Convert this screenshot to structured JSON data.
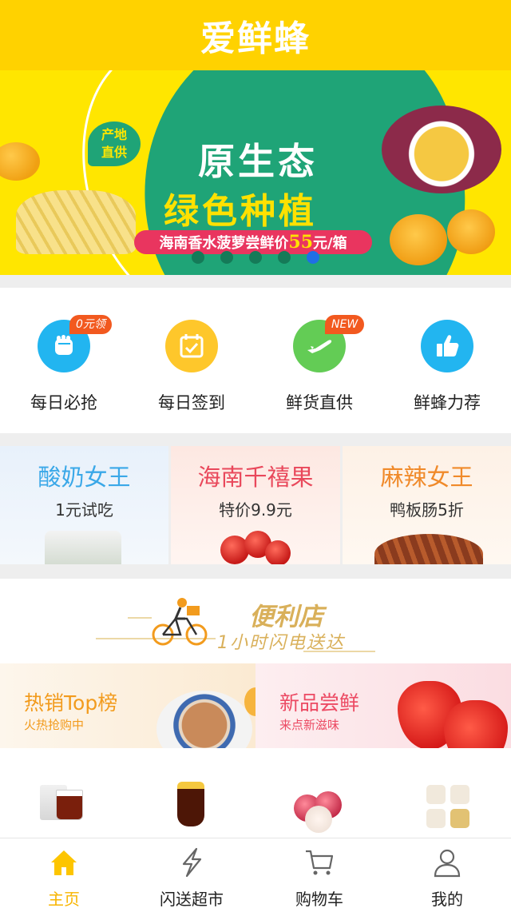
{
  "header": {
    "title": "爱鲜蜂"
  },
  "banner": {
    "tag": "产地直供",
    "title_line1": "原生态",
    "title_line2": "绿色种植",
    "strip_prefix": "海南香水菠萝尝鲜价",
    "strip_price": "55",
    "strip_suffix": "元/箱",
    "dot_count": 5,
    "active_dot": 5
  },
  "quick_menu": [
    {
      "label": "每日必抢",
      "icon": "fist-icon",
      "color": "#22b5f0",
      "badge": "0元领"
    },
    {
      "label": "每日签到",
      "icon": "calendar-check-icon",
      "color": "#fec72b",
      "badge": ""
    },
    {
      "label": "鲜货直供",
      "icon": "plane-icon",
      "color": "#63cc55",
      "badge": "NEW"
    },
    {
      "label": "鲜蜂力荐",
      "icon": "thumbs-up-icon",
      "color": "#22b5f0",
      "badge": ""
    }
  ],
  "promos": [
    {
      "title": "酸奶女王",
      "subtitle": "1元试吃",
      "color": "#3aa8e8"
    },
    {
      "title": "海南千禧果",
      "subtitle": "特价9.9元",
      "color": "#e9485b"
    },
    {
      "title": "麻辣女王",
      "subtitle": "鸭板肠5折",
      "color": "#f08a2a"
    }
  ],
  "convenience": {
    "title": "便利店",
    "subtitle": "1小时闪电送达"
  },
  "hot_new": [
    {
      "title": "热销Top榜",
      "subtitle": "火热抢购中",
      "color": "#f29b1d"
    },
    {
      "title": "新品尝鲜",
      "subtitle": "来点新滋味",
      "color": "#ec4a63"
    }
  ],
  "tabbar": {
    "items": [
      {
        "label": "主页",
        "icon": "home-icon"
      },
      {
        "label": "闪送超市",
        "icon": "lightning-icon"
      },
      {
        "label": "购物车",
        "icon": "cart-icon"
      },
      {
        "label": "我的",
        "icon": "user-icon"
      }
    ],
    "active_color": "#f8b500",
    "active_index": 0
  },
  "colors": {
    "brand_yellow": "#ffd200",
    "banner_green": "#1fa477"
  }
}
